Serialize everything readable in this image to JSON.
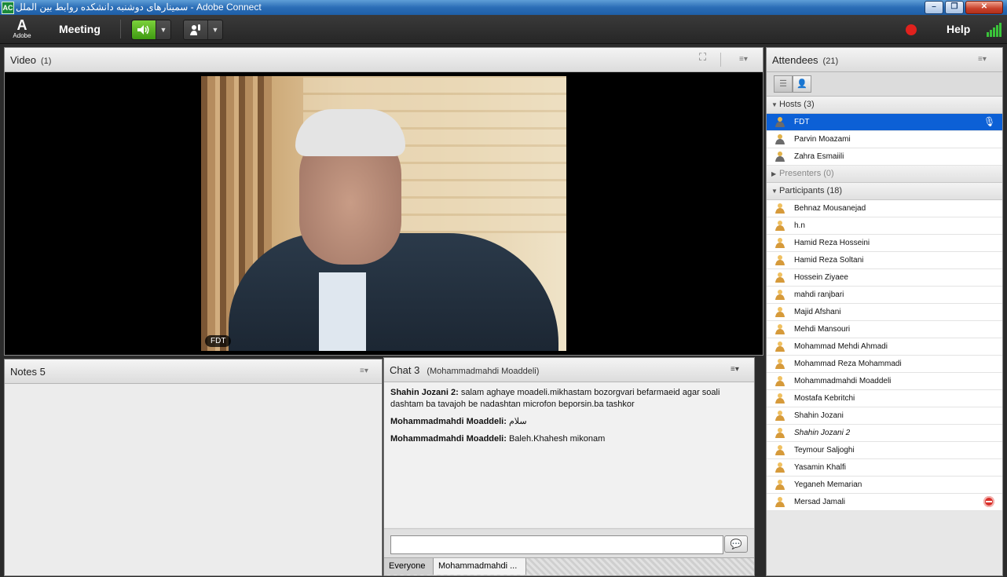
{
  "window": {
    "title": "سمینارهای دوشنبه دانشکده روابط بین الملل - Adobe Connect",
    "app_icon": "adobe-connect-icon",
    "buttons": [
      "minimize",
      "maximize",
      "close"
    ]
  },
  "appbar": {
    "logo_text": "Adobe",
    "meeting_menu": "Meeting",
    "help_label": "Help",
    "record_color": "#e0211d"
  },
  "video_pod": {
    "title": "Video",
    "count": "(1)",
    "feed_label": "FDT"
  },
  "notes_pod": {
    "title": "Notes 5"
  },
  "chat_pod": {
    "title": "Chat 3",
    "subtitle": "(Mohammadmahdi Moaddeli)",
    "messages": [
      {
        "sender": "Shahin Jozani 2:",
        "text": "salam aghaye moadeli.mikhastam bozorgvari befarmaeid agar soali dashtam ba tavajoh be nadashtan microfon beporsin.ba tashkor"
      },
      {
        "sender": "Mohammadmahdi Moaddeli:",
        "text": "سلام"
      },
      {
        "sender": "Mohammadmahdi Moaddeli:",
        "text": "Baleh.Khahesh mikonam"
      }
    ],
    "input_value": "",
    "tabs": [
      "Everyone",
      "Mohammadmahdi ..."
    ]
  },
  "attendees_pod": {
    "title": "Attendees",
    "count": "(21)",
    "groups": {
      "hosts": {
        "label": "Hosts (3)",
        "members": [
          "FDT",
          "Parvin Moazami",
          "Zahra Esmaiili"
        ]
      },
      "presenters": {
        "label": "Presenters (0)"
      },
      "participants": {
        "label": "Participants (18)",
        "members": [
          "Behnaz Mousanejad",
          "h.n",
          "Hamid Reza Hosseini",
          "Hamid Reza Soltani",
          "Hossein Ziyaee",
          "mahdi ranjbari",
          "Majid Afshani",
          "Mehdi Mansouri",
          "Mohammad Mehdi Ahmadi",
          "Mohammad Reza Mohammadi",
          "Mohammadmahdi Moaddeli",
          "Mostafa Kebritchi",
          "Shahin Jozani",
          "Shahin Jozani 2",
          "Teymour Saljoghi",
          "Yasamin Khalfi",
          "Yeganeh Memarian",
          "Mersad Jamali"
        ]
      }
    },
    "selected_color": "#0c60d6"
  }
}
